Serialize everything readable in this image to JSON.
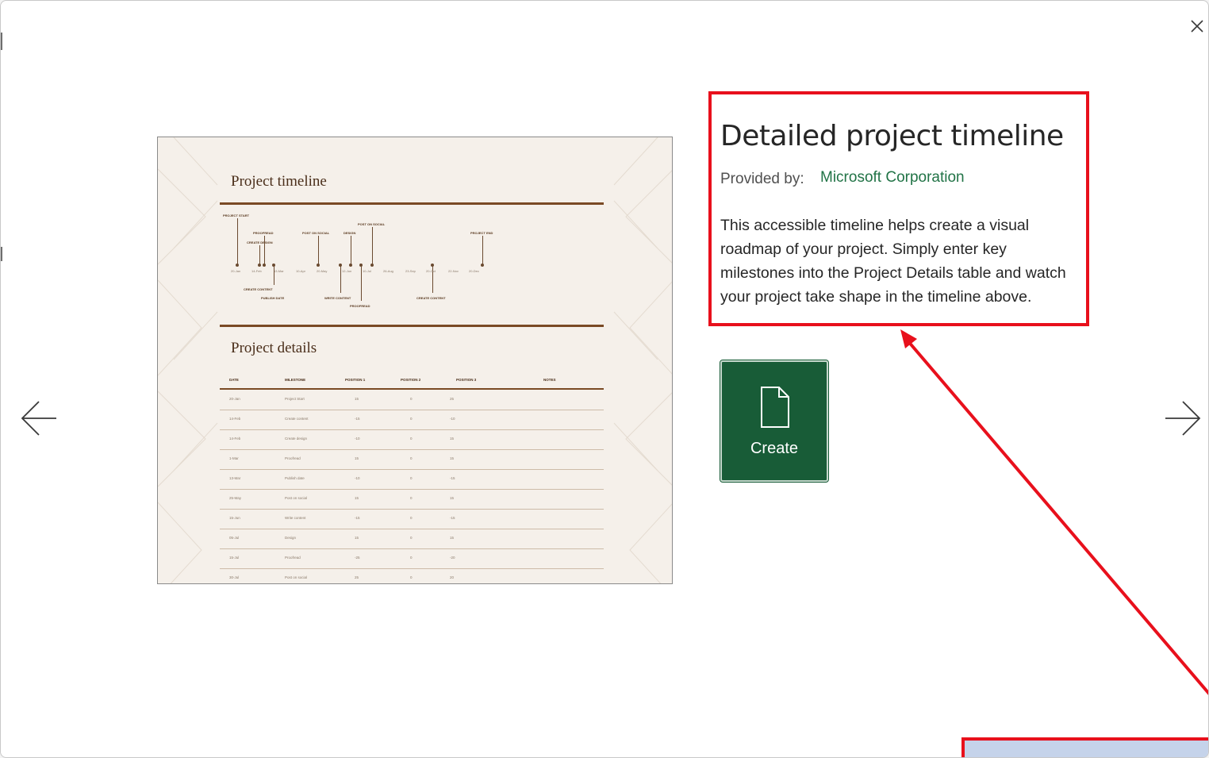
{
  "window": {
    "close_icon": "close-icon",
    "prev_icon": "arrow-left-icon",
    "next_icon": "arrow-right-icon"
  },
  "template": {
    "title": "Detailed project timeline",
    "provided_by_label": "Provided by:",
    "provider": "Microsoft Corporation",
    "description": "This accessible timeline helps create a visual roadmap of your project. Simply enter key milestones into the Project Details table and watch your project take shape in the timeline above.",
    "create_label": "Create",
    "create_icon": "document-icon"
  },
  "preview": {
    "timeline_title": "Project timeline",
    "details_title": "Project details",
    "milestones_above": [
      "PROJECT START",
      "PROOFREAD",
      "CREATE DESIGN",
      "POST ON SOCIAL",
      "DESIGN",
      "POST ON SOCIAL",
      "PROJECT END"
    ],
    "milestones_below": [
      "CREATE CONTENT",
      "PUBLISH DATE",
      "WRITE CONTENT",
      "PROOFREAD",
      "CREATE CONTENT"
    ],
    "dates": [
      "20-Jan",
      "14-Feb",
      "13-Mar",
      "10-Apr",
      "20-May",
      "12-Jun",
      "10-Jul",
      "26-Aug",
      "23-Sep",
      "20-Oct",
      "22-Nov",
      "20-Dec"
    ],
    "columns": [
      "DATE",
      "MILESTONE",
      "POSITION 1",
      "POSITION 2",
      "POSITION 3",
      "NOTES"
    ],
    "rows": [
      [
        "20-Jan",
        "Project Start",
        "15",
        "0",
        "25"
      ],
      [
        "14-Feb",
        "Create content",
        "-15",
        "0",
        "-10"
      ],
      [
        "14-Feb",
        "Create design",
        "-10",
        "0",
        "15"
      ],
      [
        "1-Mar",
        "Proofread",
        "15",
        "0",
        "15"
      ],
      [
        "13-Mar",
        "Publish date",
        "-10",
        "0",
        "-15"
      ],
      [
        "25-May",
        "Post on social",
        "15",
        "0",
        "15"
      ],
      [
        "15-Jun",
        "Write content",
        "-15",
        "0",
        "-15"
      ],
      [
        "05-Jul",
        "Design",
        "15",
        "0",
        "15"
      ],
      [
        "15-Jul",
        "Proofread",
        "-25",
        "0",
        "-20"
      ],
      [
        "30-Jul",
        "Post on social",
        "25",
        "0",
        "20"
      ]
    ]
  },
  "annotation": {
    "highlight_color": "#e8101c",
    "callout_color": "#c5d3ea"
  }
}
